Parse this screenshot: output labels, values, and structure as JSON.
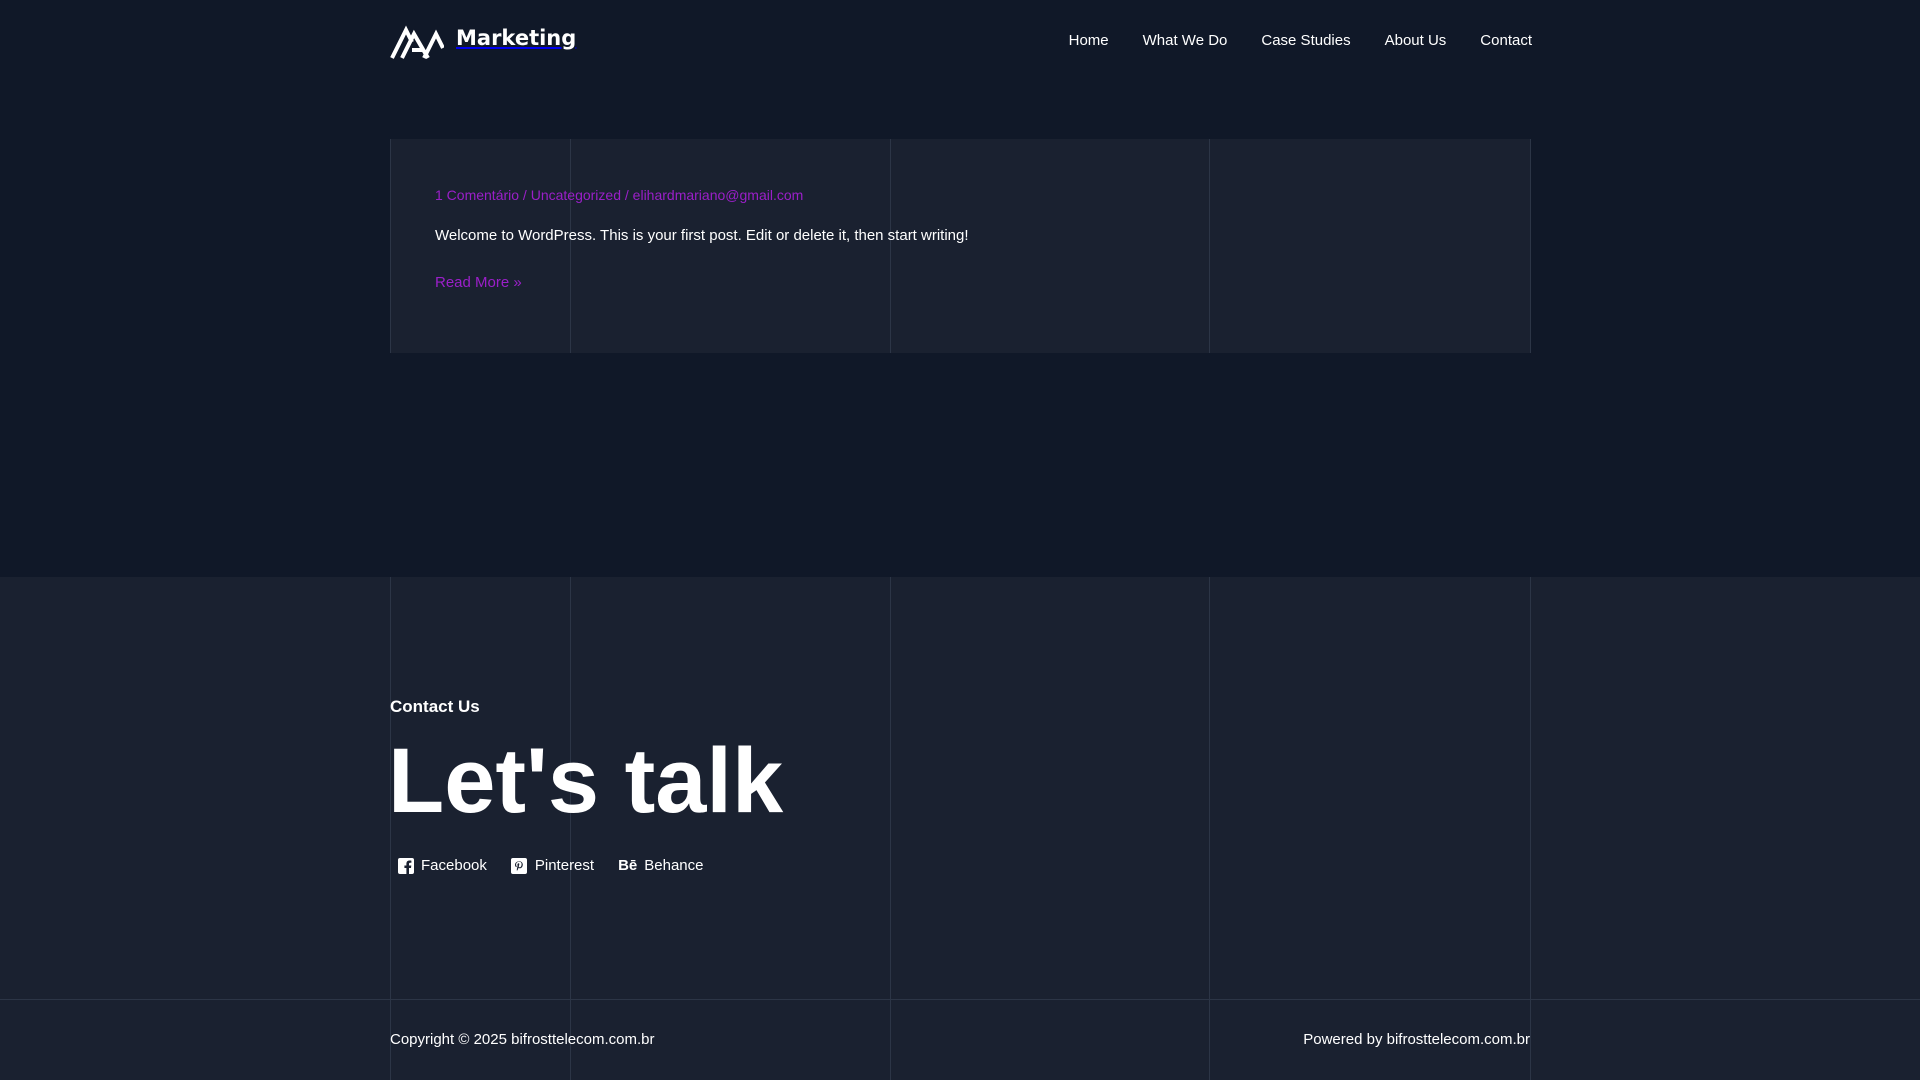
{
  "header": {
    "brand": "Marketing",
    "nav": [
      "Home",
      "What We Do",
      "Case Studies",
      "About Us",
      "Contact"
    ]
  },
  "post": {
    "meta_comments": "1 Comentário",
    "meta_sep": " / ",
    "meta_category": "Uncategorized",
    "meta_author": "elihardmariano@gmail.com",
    "excerpt": "Welcome to WordPress. This is your first post. Edit or delete it, then start writing!",
    "read_more": "Read More »"
  },
  "contact": {
    "eyebrow": "Contact Us",
    "title": "Let's talk",
    "socials": [
      {
        "label": "Facebook",
        "icon": "facebook-icon"
      },
      {
        "label": "Pinterest",
        "icon": "pinterest-icon"
      },
      {
        "label": "Behance",
        "icon": "behance-icon"
      }
    ]
  },
  "footer": {
    "copyright": "Copyright © 2025 bifrosttelecom.com.br",
    "powered": "Powered by bifrosttelecom.com.br"
  },
  "colors": {
    "background": "#101828",
    "panel": "#1a2130",
    "accent": "#9b1fc9",
    "gridline": "#2c3546"
  }
}
